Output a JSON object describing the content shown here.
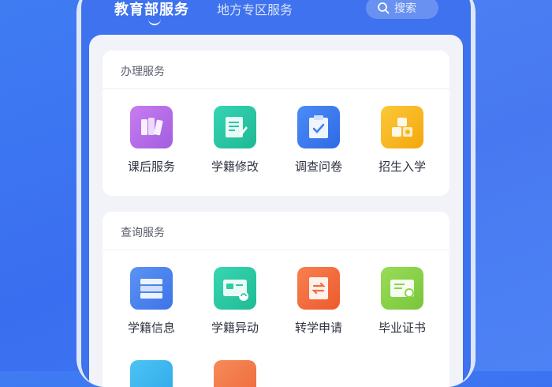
{
  "header": {
    "active_tab": "教育部服务",
    "inactive_tab": "地方专区服务",
    "search_placeholder": "搜索"
  },
  "sections": [
    {
      "title": "办理服务",
      "items": [
        {
          "label": "课后服务",
          "icon": "books-icon",
          "color": "#b86be6"
        },
        {
          "label": "学籍修改",
          "icon": "edit-document-icon",
          "color": "#2cc6a7"
        },
        {
          "label": "调查问卷",
          "icon": "clipboard-check-icon",
          "color": "#3f7ef0"
        },
        {
          "label": "招生入学",
          "icon": "enrollment-icon",
          "color": "#f6b81f"
        }
      ]
    },
    {
      "title": "查询服务",
      "items": [
        {
          "label": "学籍信息",
          "icon": "record-stack-icon",
          "color": "#4f86ee"
        },
        {
          "label": "学籍异动",
          "icon": "card-transfer-icon",
          "color": "#2ccca4"
        },
        {
          "label": "转学申请",
          "icon": "transfer-document-icon",
          "color": "#f46a3e"
        },
        {
          "label": "毕业证书",
          "icon": "certificate-icon",
          "color": "#8bd44a"
        }
      ]
    }
  ],
  "colors": {
    "background": "#3e72ee",
    "extra_icon_1": "#3fb8f0",
    "extra_icon_2": "#f47a4a"
  }
}
